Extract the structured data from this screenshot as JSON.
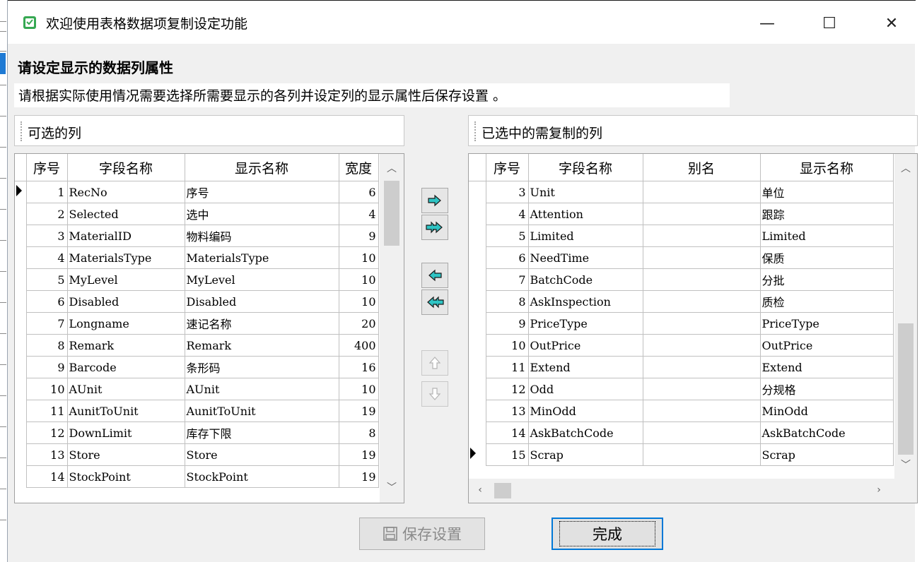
{
  "window": {
    "title": "欢迎使用表格数据项复制设定功能",
    "minimize": "—",
    "maximize": "☐",
    "close": "✕"
  },
  "header": {
    "title": "请设定显示的数据列属性",
    "description": "请根据实际使用情况需要选择所需要显示的各列并设定列的显示属性后保存设置 。"
  },
  "left_panel": {
    "label": "可选的列",
    "columns": [
      "序号",
      "字段名称",
      "显示名称",
      "宽度"
    ],
    "rows": [
      {
        "no": "1",
        "field": "RecNo",
        "display": "序号",
        "width": "6"
      },
      {
        "no": "2",
        "field": "Selected",
        "display": "选中",
        "width": "4"
      },
      {
        "no": "3",
        "field": "MaterialID",
        "display": "物料编码",
        "width": "9"
      },
      {
        "no": "4",
        "field": "MaterialsType",
        "display": "MaterialsType",
        "width": "10"
      },
      {
        "no": "5",
        "field": "MyLevel",
        "display": "MyLevel",
        "width": "10"
      },
      {
        "no": "6",
        "field": "Disabled",
        "display": "Disabled",
        "width": "10"
      },
      {
        "no": "7",
        "field": "Longname",
        "display": "速记名称",
        "width": "20"
      },
      {
        "no": "8",
        "field": "Remark",
        "display": "Remark",
        "width": "400"
      },
      {
        "no": "9",
        "field": "Barcode",
        "display": "条形码",
        "width": "16"
      },
      {
        "no": "10",
        "field": "AUnit",
        "display": "AUnit",
        "width": "10"
      },
      {
        "no": "11",
        "field": "AunitToUnit",
        "display": "AunitToUnit",
        "width": "19"
      },
      {
        "no": "12",
        "field": "DownLimit",
        "display": "库存下限",
        "width": "8"
      },
      {
        "no": "13",
        "field": "Store",
        "display": "Store",
        "width": "19"
      },
      {
        "no": "14",
        "field": "StockPoint",
        "display": "StockPoint",
        "width": "19"
      }
    ]
  },
  "right_panel": {
    "label": "已选中的需复制的列",
    "columns": [
      "序号",
      "字段名称",
      "别名",
      "显示名称"
    ],
    "rows": [
      {
        "no": "3",
        "field": "Unit",
        "alias": "",
        "display": "单位"
      },
      {
        "no": "4",
        "field": "Attention",
        "alias": "",
        "display": "跟踪"
      },
      {
        "no": "5",
        "field": "Limited",
        "alias": "",
        "display": "Limited"
      },
      {
        "no": "6",
        "field": "NeedTime",
        "alias": "",
        "display": "保质"
      },
      {
        "no": "7",
        "field": "BatchCode",
        "alias": "",
        "display": "分批"
      },
      {
        "no": "8",
        "field": "AskInspection",
        "alias": "",
        "display": "质检"
      },
      {
        "no": "9",
        "field": "PriceType",
        "alias": "",
        "display": "PriceType"
      },
      {
        "no": "10",
        "field": "OutPrice",
        "alias": "",
        "display": "OutPrice"
      },
      {
        "no": "11",
        "field": "Extend",
        "alias": "",
        "display": "Extend"
      },
      {
        "no": "12",
        "field": "Odd",
        "alias": "",
        "display": "分规格"
      },
      {
        "no": "13",
        "field": "MinOdd",
        "alias": "",
        "display": "MinOdd"
      },
      {
        "no": "14",
        "field": "AskBatchCode",
        "alias": "",
        "display": "AskBatchCode"
      },
      {
        "no": "15",
        "field": "Scrap",
        "alias": "",
        "display": "Scrap"
      }
    ]
  },
  "buttons": {
    "save": "保存设置",
    "done": "完成"
  },
  "colors": {
    "arrow_fill": "#2ec4c4",
    "focus_border": "#0078d7",
    "app_icon": "#36a852"
  },
  "icons": {
    "move_right": "arrow-right-icon",
    "move_all_right": "double-arrow-right-icon",
    "move_left": "arrow-left-icon",
    "move_all_left": "double-arrow-left-icon",
    "move_up": "arrow-up-icon",
    "move_down": "arrow-down-icon",
    "save": "floppy-disk-icon"
  }
}
